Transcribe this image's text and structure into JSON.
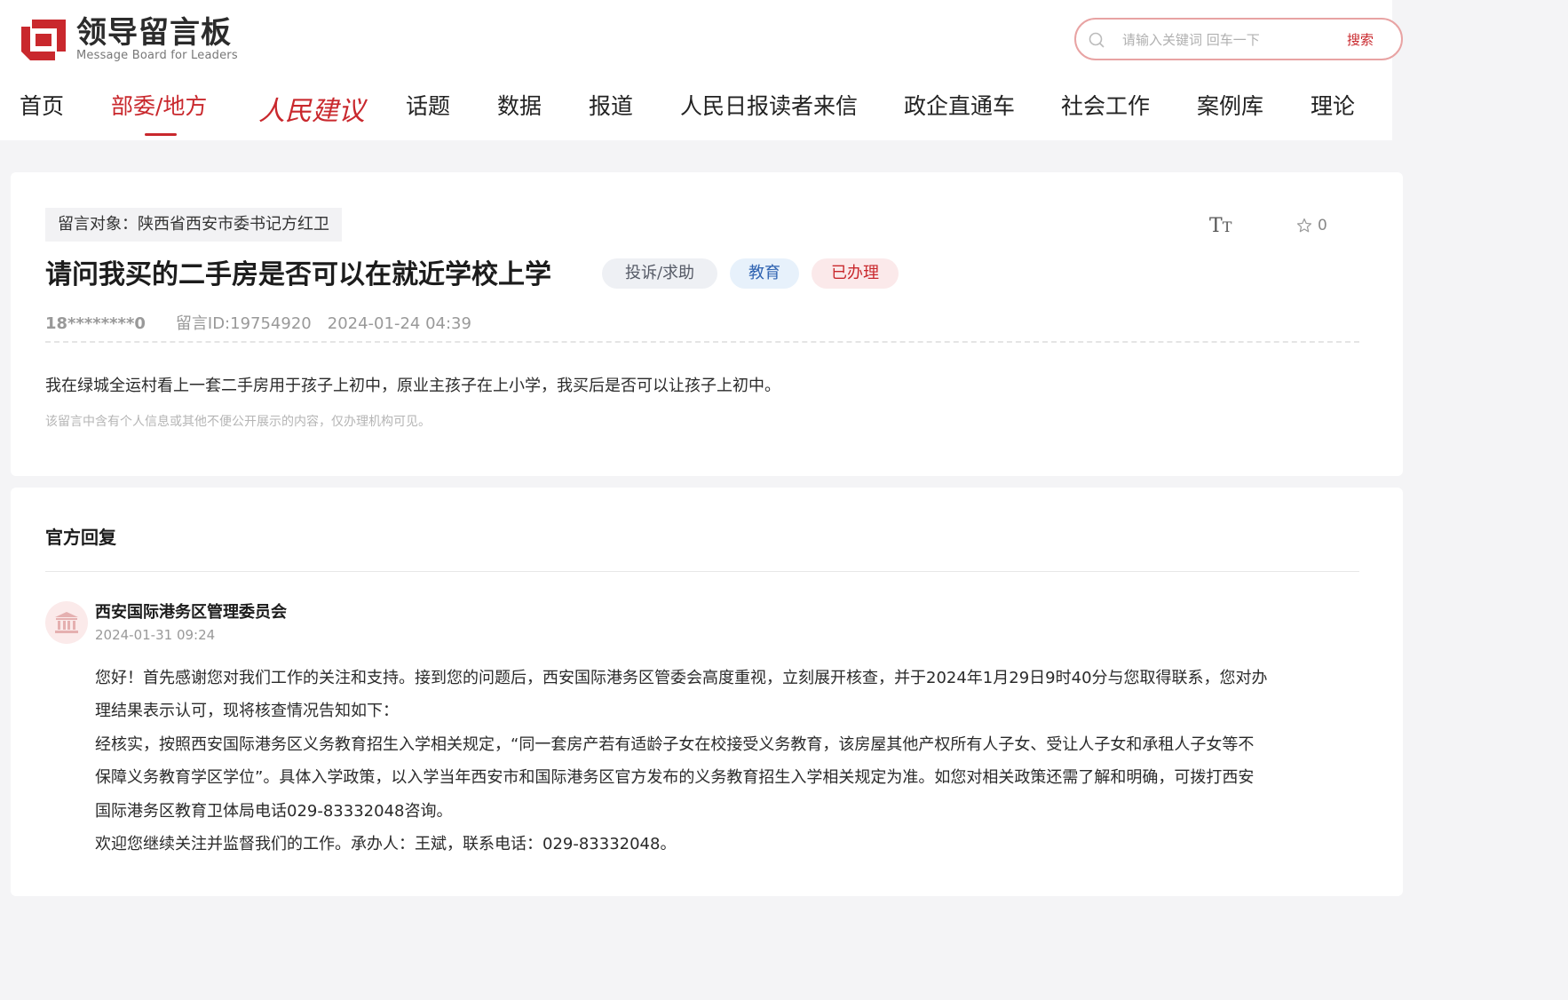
{
  "header": {
    "logo_cn": "领导留言板",
    "logo_en": "Message Board for Leaders",
    "search_placeholder": "请输入关键词 回车一下",
    "search_button": "搜索"
  },
  "nav": {
    "items": [
      "首页",
      "部委/地方",
      "人民建议",
      "话题",
      "数据",
      "报道",
      "人民日报读者来信",
      "政企直通车",
      "社会工作",
      "案例库",
      "理论"
    ],
    "active_index": 1
  },
  "message": {
    "target": "留言对象：陕西省西安市委书记方红卫",
    "favorite_count": "0",
    "title": "请问我买的二手房是否可以在就近学校上学",
    "tags": [
      "投诉/求助",
      "教育",
      "已办理"
    ],
    "user": "18********0",
    "message_id": "留言ID:19754920",
    "time": "2024-01-24 04:39",
    "content": "我在绿城全运村看上一套二手房用于孩子上初中，原业主孩子在上小学，我买后是否可以让孩子上初中。",
    "privacy_note": "该留言中含有个人信息或其他不便公开展示的内容，仅办理机构可见。"
  },
  "reply": {
    "heading": "官方回复",
    "org": "西安国际港务区管理委员会",
    "time": "2024-01-31 09:24",
    "lines": [
      "您好！首先感谢您对我们工作的关注和支持。接到您的问题后，西安国际港务区管委会高度重视，立刻展开核查，并于2024年1月29日9时40分与您取得联系，您对办",
      "理结果表示认可，现将核查情况告知如下：",
      "经核实，按照西安国际港务区义务教育招生入学相关规定，“同一套房产若有适龄子女在校接受义务教育，该房屋其他产权所有人子女、受让人子女和承租人子女等不",
      "保障义务教育学区学位”。具体入学政策，以入学当年西安市和国际港务区官方发布的义务教育招生入学相关规定为准。如您对相关政策还需了解和明确，可拨打西安",
      "国际港务区教育卫体局电话029-83332048咨询。",
      "欢迎您继续关注并监督我们的工作。承办人：王斌，联系电话：029-83332048。"
    ]
  },
  "colors": {
    "brand_red": "#c9282d",
    "tag_blue": "#2f63b1"
  }
}
